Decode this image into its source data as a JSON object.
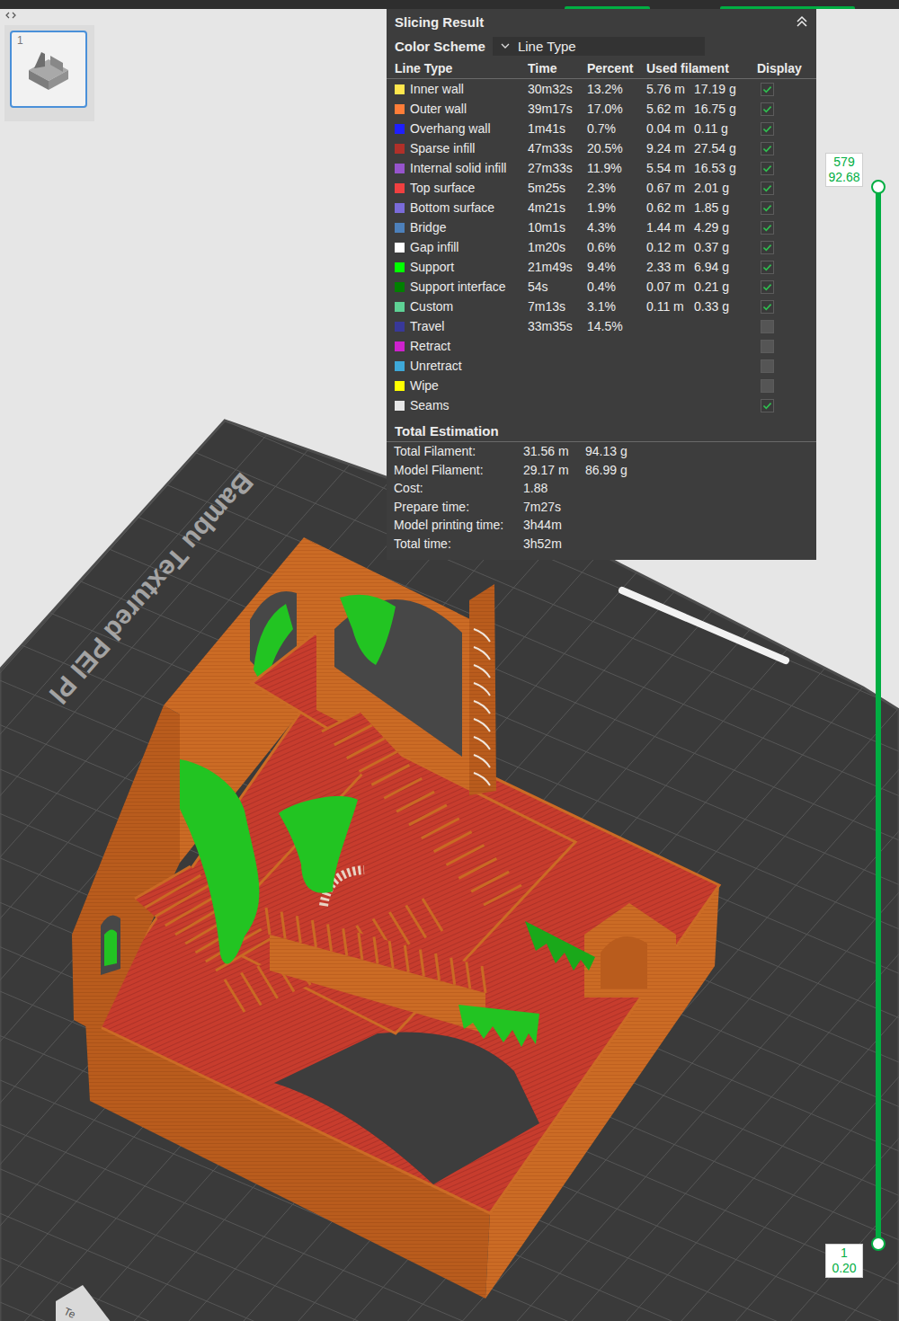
{
  "sidebar": {
    "thumbnails": [
      {
        "label": "1",
        "selected": true
      }
    ]
  },
  "slicing_result": {
    "title": "Slicing Result",
    "color_scheme": {
      "label": "Color Scheme",
      "value": "Line Type"
    },
    "columns": [
      "Line Type",
      "Time",
      "Percent",
      "Used filament",
      "Display"
    ],
    "rows": [
      {
        "name": "Inner wall",
        "color": "#ffe64d",
        "time": "30m32s",
        "percent": "13.2%",
        "length": "5.76 m",
        "weight": "17.19 g",
        "displayed": true
      },
      {
        "name": "Outer wall",
        "color": "#ff7d38",
        "time": "39m17s",
        "percent": "17.0%",
        "length": "5.62 m",
        "weight": "16.75 g",
        "displayed": true
      },
      {
        "name": "Overhang wall",
        "color": "#1f1fff",
        "time": "1m41s",
        "percent": "0.7%",
        "length": "0.04 m",
        "weight": "0.11 g",
        "displayed": true
      },
      {
        "name": "Sparse infill",
        "color": "#b03029",
        "time": "47m33s",
        "percent": "20.5%",
        "length": "9.24 m",
        "weight": "27.54 g",
        "displayed": true
      },
      {
        "name": "Internal solid infill",
        "color": "#9654cc",
        "time": "27m33s",
        "percent": "11.9%",
        "length": "5.54 m",
        "weight": "16.53 g",
        "displayed": true
      },
      {
        "name": "Top surface",
        "color": "#f04040",
        "time": "5m25s",
        "percent": "2.3%",
        "length": "0.67 m",
        "weight": "2.01 g",
        "displayed": true
      },
      {
        "name": "Bottom surface",
        "color": "#7a6bd9",
        "time": "4m21s",
        "percent": "1.9%",
        "length": "0.62 m",
        "weight": "1.85 g",
        "displayed": true
      },
      {
        "name": "Bridge",
        "color": "#4d80ba",
        "time": "10m1s",
        "percent": "4.3%",
        "length": "1.44 m",
        "weight": "4.29 g",
        "displayed": true
      },
      {
        "name": "Gap infill",
        "color": "#ffffff",
        "time": "1m20s",
        "percent": "0.6%",
        "length": "0.12 m",
        "weight": "0.37 g",
        "displayed": true
      },
      {
        "name": "Support",
        "color": "#00ff00",
        "time": "21m49s",
        "percent": "9.4%",
        "length": "2.33 m",
        "weight": "6.94 g",
        "displayed": true
      },
      {
        "name": "Support interface",
        "color": "#008000",
        "time": "54s",
        "percent": "0.4%",
        "length": "0.07 m",
        "weight": "0.21 g",
        "displayed": true
      },
      {
        "name": "Custom",
        "color": "#5ed194",
        "time": "7m13s",
        "percent": "3.1%",
        "length": "0.11 m",
        "weight": "0.33 g",
        "displayed": true
      },
      {
        "name": "Travel",
        "color": "#383899",
        "time": "33m35s",
        "percent": "14.5%",
        "displayed": false
      },
      {
        "name": "Retract",
        "color": "#cd22cd",
        "displayed": false
      },
      {
        "name": "Unretract",
        "color": "#3ea8d8",
        "displayed": false
      },
      {
        "name": "Wipe",
        "color": "#ffff00",
        "displayed": false
      },
      {
        "name": "Seams",
        "color": "#e6e6e6",
        "displayed": true
      }
    ],
    "total": {
      "title": "Total Estimation",
      "items": [
        {
          "label": "Total Filament:",
          "values": [
            "31.56 m",
            "94.13 g"
          ]
        },
        {
          "label": "Model Filament:",
          "values": [
            "29.17 m",
            "86.99 g"
          ]
        },
        {
          "label": "Cost:",
          "values": [
            "1.88"
          ]
        },
        {
          "label": "Prepare time:",
          "values": [
            "7m27s"
          ]
        },
        {
          "label": "Model printing time:",
          "values": [
            "3h44m"
          ]
        },
        {
          "label": "Total time:",
          "values": [
            "3h52m"
          ]
        }
      ]
    }
  },
  "layer_slider": {
    "upper": {
      "layer": "579",
      "height": "92.68"
    },
    "lower": {
      "layer": "1",
      "height": "0.20"
    },
    "level": 1
  },
  "plate": {
    "label": "Bambu Textured PEI Pl",
    "corner_label": "Te"
  }
}
